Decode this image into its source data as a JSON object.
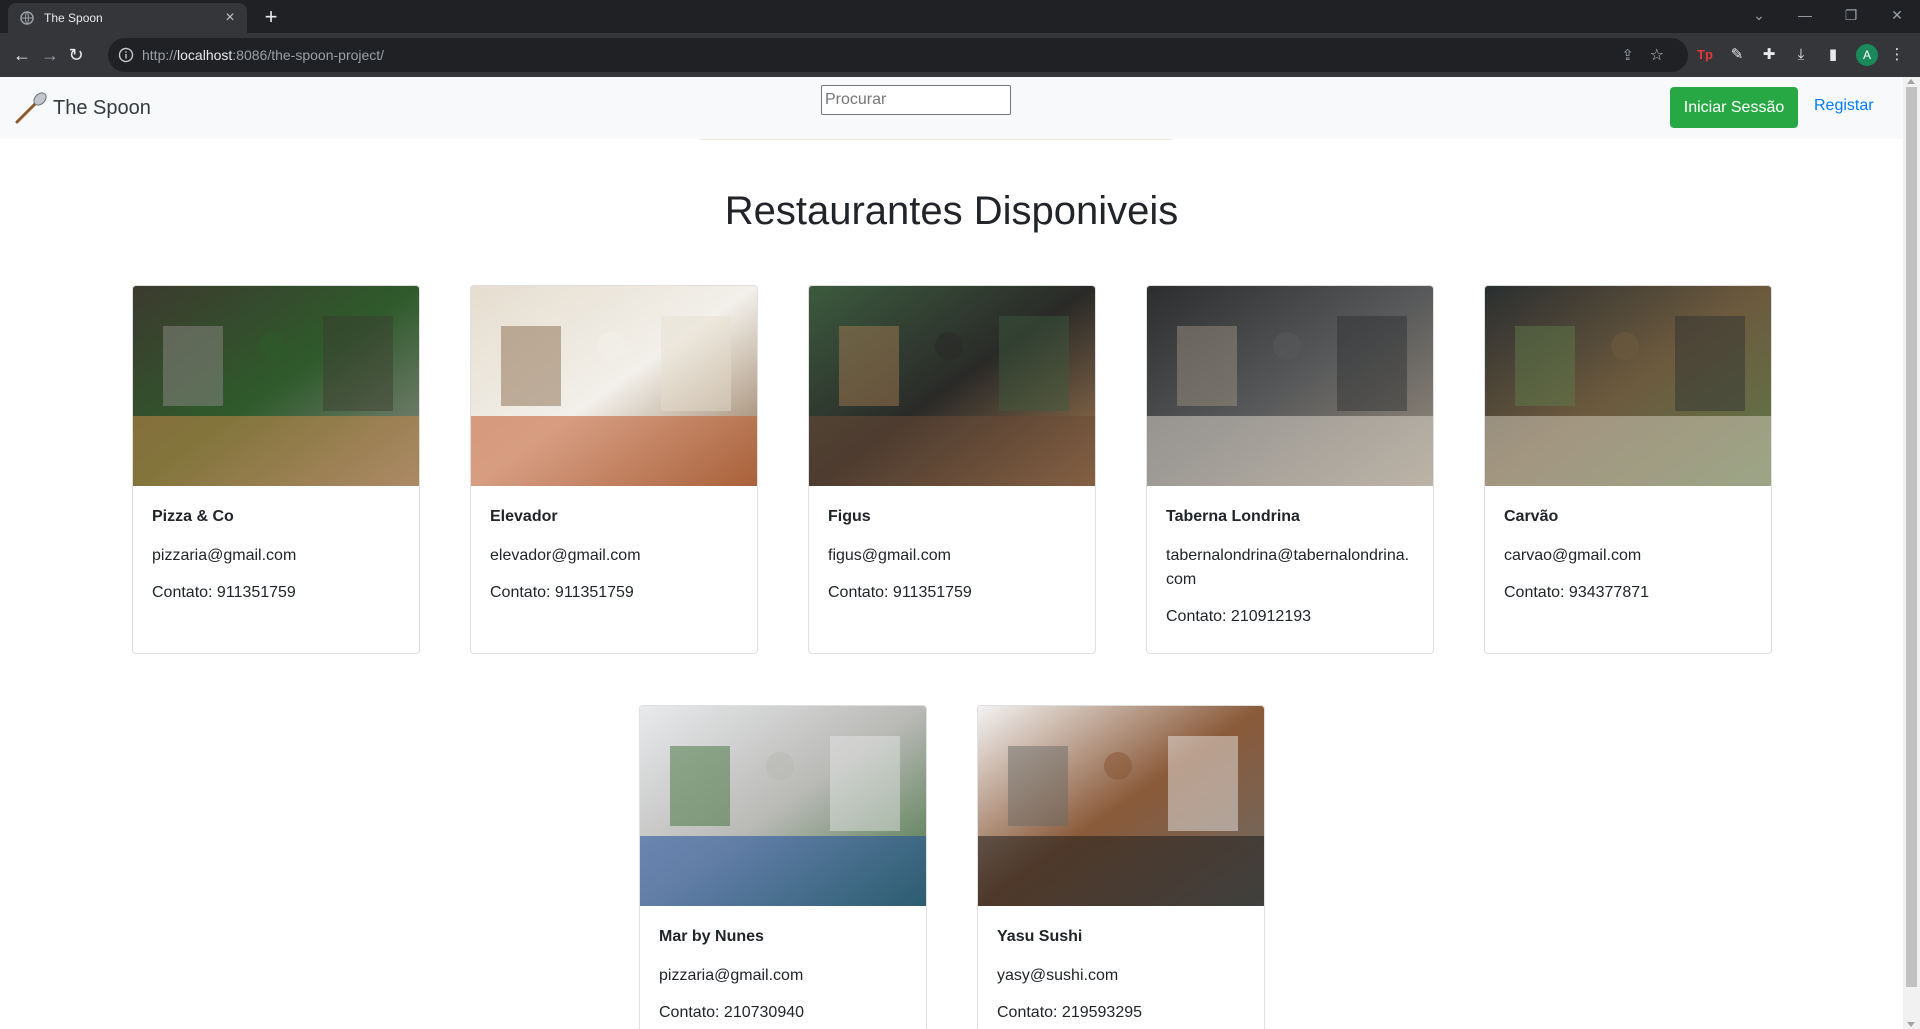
{
  "browser": {
    "tab_title": "The Spoon",
    "url_scheme_host_prefix": "http://",
    "url_host": "localhost",
    "url_rest": ":8086/the-spoon-project/",
    "avatar_letter": "A",
    "ext_tp": "Tp"
  },
  "site": {
    "brand": "The Spoon",
    "search_placeholder": "Procurar",
    "login_label": "Iniciar Sessão",
    "register_label": "Registar",
    "heading": "Restaurantes Disponiveis"
  },
  "restaurants": [
    {
      "name": "Pizza & Co",
      "email": "pizzaria@gmail.com",
      "phone": "Contato: 911351759",
      "palette": [
        "#3c3a2e",
        "#c98a4a",
        "#2f5a2c",
        "#8c8a86"
      ]
    },
    {
      "name": "Elevador",
      "email": "elevador@gmail.com",
      "phone": "Contato: 911351759",
      "palette": [
        "#e6ddcf",
        "#c15a2c",
        "#f2f0ea",
        "#8a6b4d"
      ]
    },
    {
      "name": "Figus",
      "email": "figus@gmail.com",
      "phone": "Contato: 911351759",
      "palette": [
        "#3c5a3e",
        "#6b4a36",
        "#2a2a28",
        "#a27a52"
      ]
    },
    {
      "name": "Taberna Londrina",
      "email": "tabernalondrina@tabernalondrina.com",
      "phone": "Contato: 210912193",
      "palette": [
        "#2b2d2e",
        "#d8d2c6",
        "#58595a",
        "#9a8f80"
      ]
    },
    {
      "name": "Carvão",
      "email": "carvao@gmail.com",
      "phone": "Contato: 934377871",
      "palette": [
        "#2a2e30",
        "#cfc8b8",
        "#6c5a3e",
        "#5e7a4a"
      ]
    },
    {
      "name": "Mar by Nunes",
      "email": "pizzaria@gmail.com",
      "phone": "Contato: 210730940",
      "palette": [
        "#e8eaec",
        "#1c4f9c",
        "#b9b9b6",
        "#3f6f3a"
      ]
    },
    {
      "name": "Yasu Sushi",
      "email": "yasy@sushi.com",
      "phone": "Contato: 219593295",
      "palette": [
        "#f3f3f3",
        "#1d1d1d",
        "#8a5a3a",
        "#6a6a66"
      ]
    }
  ]
}
